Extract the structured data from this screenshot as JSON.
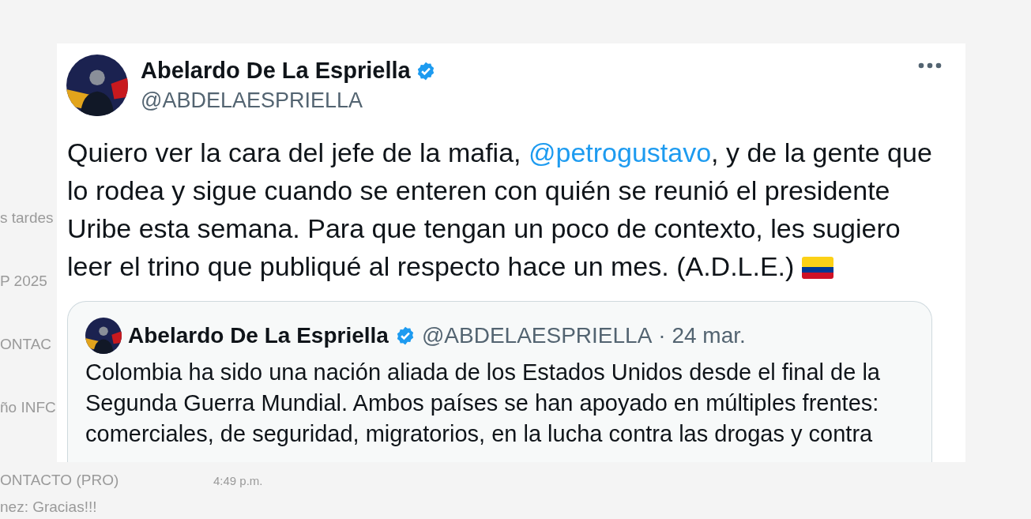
{
  "background": {
    "left_fragments": [
      "s tardes",
      "P 2025",
      "ONTAC",
      "ño INFC"
    ],
    "chat_row": {
      "title": "ONTACTO (PRO)",
      "time": "4:49 p.m.",
      "preview": "nez: Gracias!!!"
    }
  },
  "post": {
    "author": {
      "name": "Abelardo De La Espriella",
      "verified": true,
      "handle": "@ABDELAESPRIELLA"
    },
    "body": [
      {
        "kind": "text",
        "text": "Quiero ver la cara del jefe de la mafia, "
      },
      {
        "kind": "mention",
        "text": "@petrogustavo"
      },
      {
        "kind": "text",
        "text": ", y de la gente que lo rodea y sigue cuando se enteren con quién se reunió el presidente Uribe esta semana. Para que tengan un poco de contexto, les sugiero leer el trino que publiqué al respecto hace un mes. (A.D.L.E.)"
      },
      {
        "kind": "flag"
      }
    ],
    "quote": {
      "author": {
        "name": "Abelardo De La Espriella",
        "verified": true,
        "handle": "@ABDELAESPRIELLA",
        "date": "· 24 mar."
      },
      "text": "Colombia ha sido una nación aliada de los Estados Unidos desde el final de la Segunda Guerra Mundial. Ambos países se han apoyado en múltiples frentes: comerciales, de seguridad, migratorios, en la lucha contra las drogas y contra"
    }
  }
}
